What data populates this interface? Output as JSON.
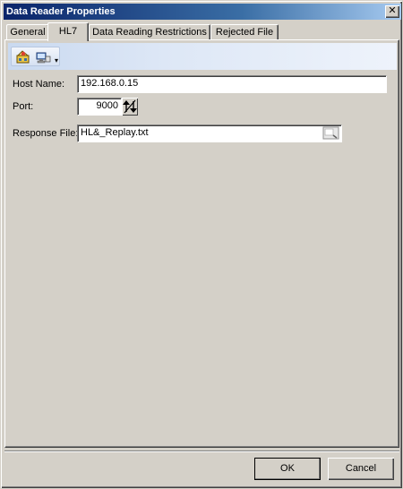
{
  "window": {
    "title": "Data Reader Properties",
    "close_glyph": "✕"
  },
  "tabs": [
    {
      "label": "General",
      "active": false
    },
    {
      "label": "HL7",
      "active": true
    },
    {
      "label": "Data Reading Restrictions",
      "active": false
    },
    {
      "label": "Rejected File",
      "active": false
    }
  ],
  "toolbar": {
    "buttons": [
      {
        "icon": "connect-icon"
      },
      {
        "icon": "network-computer-icon"
      }
    ],
    "overflow_glyph": "▾"
  },
  "form": {
    "host_name": {
      "label": "Host Name:",
      "value": "192.168.0.15"
    },
    "port": {
      "label": "Port:",
      "value": "9000"
    },
    "response_file": {
      "label": "Response File:",
      "value": "HL&_Replay.txt"
    }
  },
  "footer": {
    "ok_label": "OK",
    "cancel_label": "Cancel"
  },
  "colors": {
    "face": "#d4d0c8",
    "title_start": "#0a246a",
    "title_end": "#a6caf0"
  }
}
